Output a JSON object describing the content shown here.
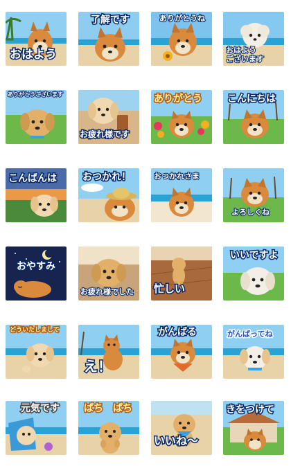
{
  "stickers": [
    {
      "caption": "おはよう"
    },
    {
      "caption": "了解です"
    },
    {
      "caption": "ありがとうね"
    },
    {
      "caption": "おはよう\nございます"
    },
    {
      "caption": "ありがとうございます"
    },
    {
      "caption": "お疲れ様です"
    },
    {
      "caption": "ありがとう"
    },
    {
      "caption": "こんにちは"
    },
    {
      "caption": "こんばんは"
    },
    {
      "caption": "おつかれ！"
    },
    {
      "caption": "おつかれさま"
    },
    {
      "caption": "よろしくね"
    },
    {
      "caption": "おやすみ"
    },
    {
      "caption": "お疲れ様でした"
    },
    {
      "caption": "忙しい"
    },
    {
      "caption": "いいですよ"
    },
    {
      "caption": "どういたしまして"
    },
    {
      "caption": "え！"
    },
    {
      "caption": "がんばる"
    },
    {
      "caption": "がんばってね"
    },
    {
      "caption": "元気です"
    },
    {
      "caption": "ぱち　ぱち"
    },
    {
      "caption": "いいね〜"
    },
    {
      "caption": "きをつけて"
    }
  ],
  "colors": {
    "sky": "#7fc4ef",
    "sea": "#2aa3d4",
    "sand": "#e8d3a8",
    "grass": "#5fae3c",
    "shiba": "#d98a3d",
    "golden": "#e3b06a",
    "cream": "#f3e3c6",
    "night": "#16244f",
    "caption_stroke": "#0a2a6a"
  }
}
